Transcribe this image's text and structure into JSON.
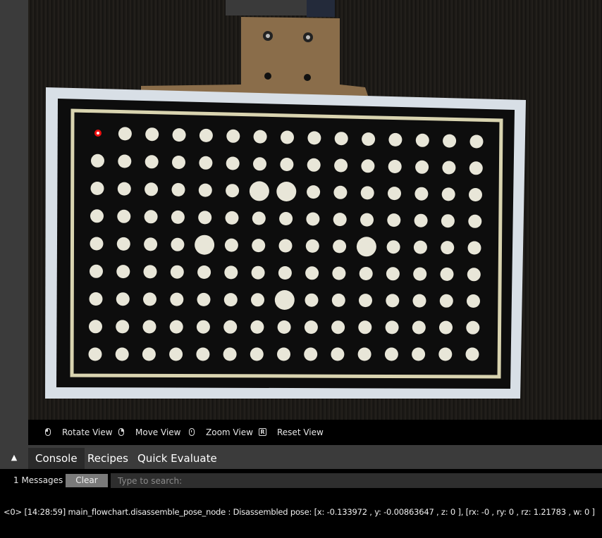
{
  "view_toolbar": {
    "items": [
      {
        "icon": "mouse-left-icon",
        "label": "Rotate View"
      },
      {
        "icon": "mouse-right-icon",
        "label": "Move View"
      },
      {
        "icon": "mouse-middle-icon",
        "label": "Zoom View"
      },
      {
        "icon": "r-key-icon",
        "key": "R",
        "label": "Reset View"
      }
    ]
  },
  "panel": {
    "collapse_icon": "▲",
    "tabs": [
      {
        "label": "Console",
        "active": true
      },
      {
        "label": "Recipes",
        "active": false
      },
      {
        "label": "Quick Evaluate",
        "active": false
      }
    ]
  },
  "console": {
    "message_count": "1 Messages",
    "clear_label": "Clear",
    "search_placeholder": "Type to search:",
    "lines": [
      "<0> [14:28:59] main_flowchart.disassemble_pose_node : Disassembled pose: [x: -0.133972 , y: -0.00863647 , z: 0 ], [rx: -0 , ry: 0 , rz: 1.21783 , w: 0 ]"
    ]
  },
  "calibration_grid": {
    "rows": 9,
    "cols": 15
  },
  "colors": {
    "panel_bg": "#3b3b3b",
    "active_tab_bg": "#2a2a2a",
    "marker_red": "#e11"
  }
}
